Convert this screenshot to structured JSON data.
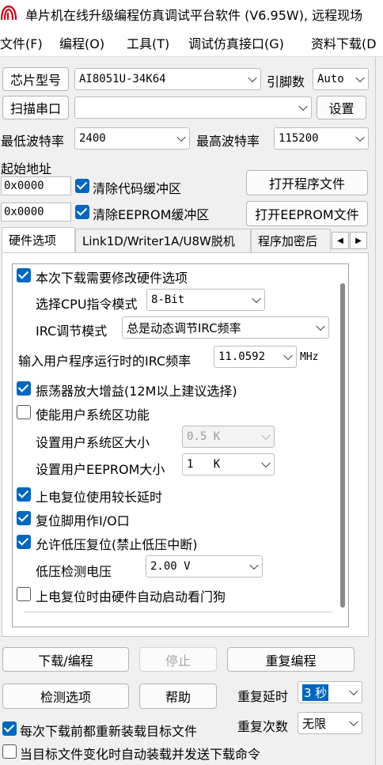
{
  "window": {
    "title": "单片机在线升级编程仿真调试平台软件 (V6.95W), 远程现场"
  },
  "menu": [
    "文件(F)",
    "编程(O)",
    "工具(T)",
    "调试仿真接口(G)",
    "资料下载(D"
  ],
  "top": {
    "chip_button": "芯片型号",
    "chip_value": "AI8051U-34K64",
    "pins_label": "引脚数",
    "pins_value": "Auto",
    "scan_button": "扫描串口",
    "port_value": "",
    "settings_button": "设置",
    "min_baud_label": "最低波特率",
    "min_baud_value": "2400",
    "max_baud_label": "最高波特率",
    "max_baud_value": "115200",
    "start_addr_label": "起始地址",
    "code_addr": "0x0000",
    "clear_code_label": "清除代码缓冲区",
    "open_program_button": "打开程序文件",
    "eeprom_addr": "0x0000",
    "clear_eeprom_label": "清除EEPROM缓冲区",
    "open_eeprom_button": "打开EEPROM文件"
  },
  "tabs": [
    "硬件选项",
    "Link1D/Writer1A/U8W脱机",
    "程序加密后"
  ],
  "hw": {
    "modify_hw_label": "本次下载需要修改硬件选项",
    "cpu_mode_label": "选择CPU指令模式",
    "cpu_mode_value": "8-Bit",
    "irc_mode_label": "IRC调节模式",
    "irc_mode_value": "总是动态调节IRC频率",
    "irc_freq_label": "输入用户程序运行时的IRC频率",
    "irc_freq_value": "11.0592",
    "irc_freq_unit": "MHz",
    "osc_gain_label": "振荡器放大增益(12M以上建议选择)",
    "user_sys_label": "使能用户系统区功能",
    "user_sys_size_label": "设置用户系统区大小",
    "user_sys_size_value": "0.5 K",
    "eeprom_size_label": "设置用户EEPROM大小",
    "eeprom_size_value": "1   K",
    "long_delay_label": "上电复位使用较长延时",
    "reset_io_label": "复位脚用作I/O口",
    "lvr_label": "允许低压复位(禁止低压中断)",
    "lvd_label": "低压检测电压",
    "lvd_value": "2.00 V",
    "wdt_label": "上电复位时由硬件自动启动看门狗",
    "checks": {
      "modify_hw": true,
      "osc_gain": true,
      "user_sys": false,
      "long_delay": true,
      "reset_io": true,
      "lvr": true,
      "wdt": false
    }
  },
  "bottom": {
    "download_button": "下载/编程",
    "stop_button": "停止",
    "repeat_button": "重复编程",
    "check_button": "检测选项",
    "help_button": "帮助",
    "repeat_delay_label": "重复延时",
    "repeat_delay_value": "3 秒",
    "repeat_count_label": "重复次数",
    "repeat_count_value": "无限",
    "reload_label": "每次下载前都重新装载目标文件",
    "auto_send_label": "当目标文件变化时自动装载并发送下载命令",
    "checks": {
      "reload": true,
      "auto_send": false
    }
  },
  "colors": {
    "accent": "#0067c0",
    "background": "#f0f0f0"
  },
  "icons": {
    "app": "app-logo-icon"
  }
}
